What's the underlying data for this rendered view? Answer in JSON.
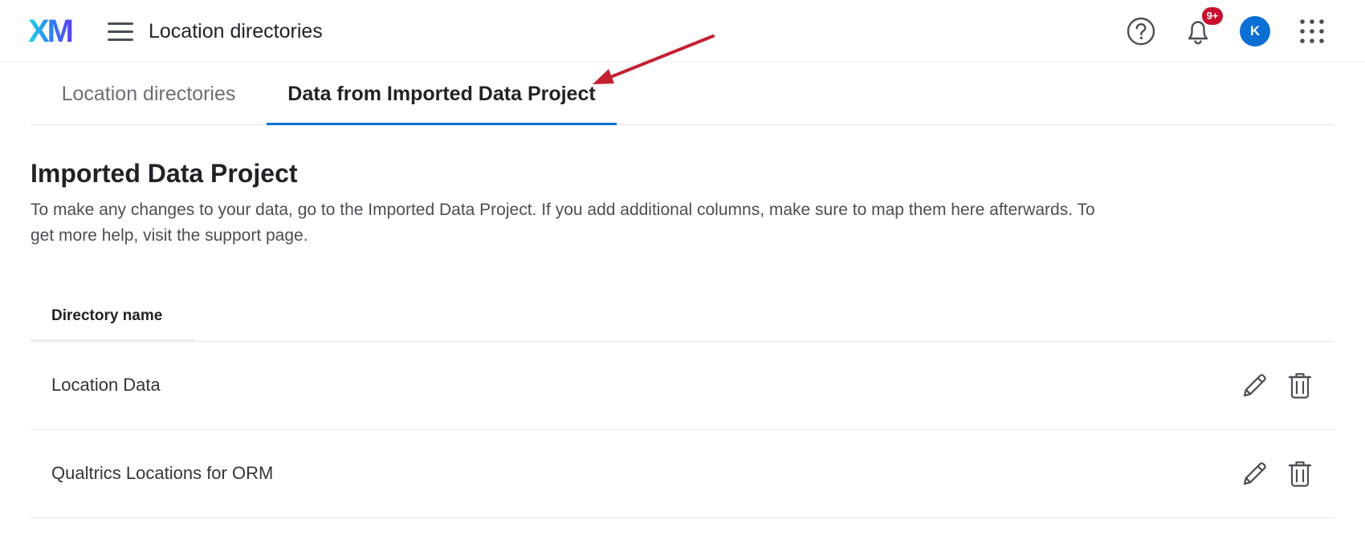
{
  "header": {
    "logo_text": "XM",
    "title": "Location directories",
    "icons": {
      "menu": "hamburger-menu-icon",
      "help": "help-icon",
      "notifications": "bell-icon",
      "apps": "apps-grid-icon"
    },
    "notification_badge": "9+",
    "avatar_initial": "K"
  },
  "tabs": [
    {
      "label": "Location directories",
      "selected": false
    },
    {
      "label": "Data from Imported Data Project",
      "selected": true
    }
  ],
  "main": {
    "title": "Imported Data Project",
    "description": "To make any changes to your data, go to the Imported Data Project. If you add additional columns, make sure to map them here afterwards. To get more help, visit the support page.",
    "table": {
      "column_header": "Directory name",
      "rows": [
        {
          "name": "Location Data",
          "actions": [
            "pencil-icon",
            "trash-icon"
          ]
        },
        {
          "name": "Qualtrics Locations for ORM",
          "actions": [
            "pencil-icon",
            "trash-icon"
          ]
        }
      ]
    }
  },
  "colors": {
    "accent": "#0b6fd4",
    "badge": "#c8102e",
    "annotation_arrow": "#c42032",
    "text_primary": "#1f2328",
    "text_secondary": "#6b7075"
  }
}
